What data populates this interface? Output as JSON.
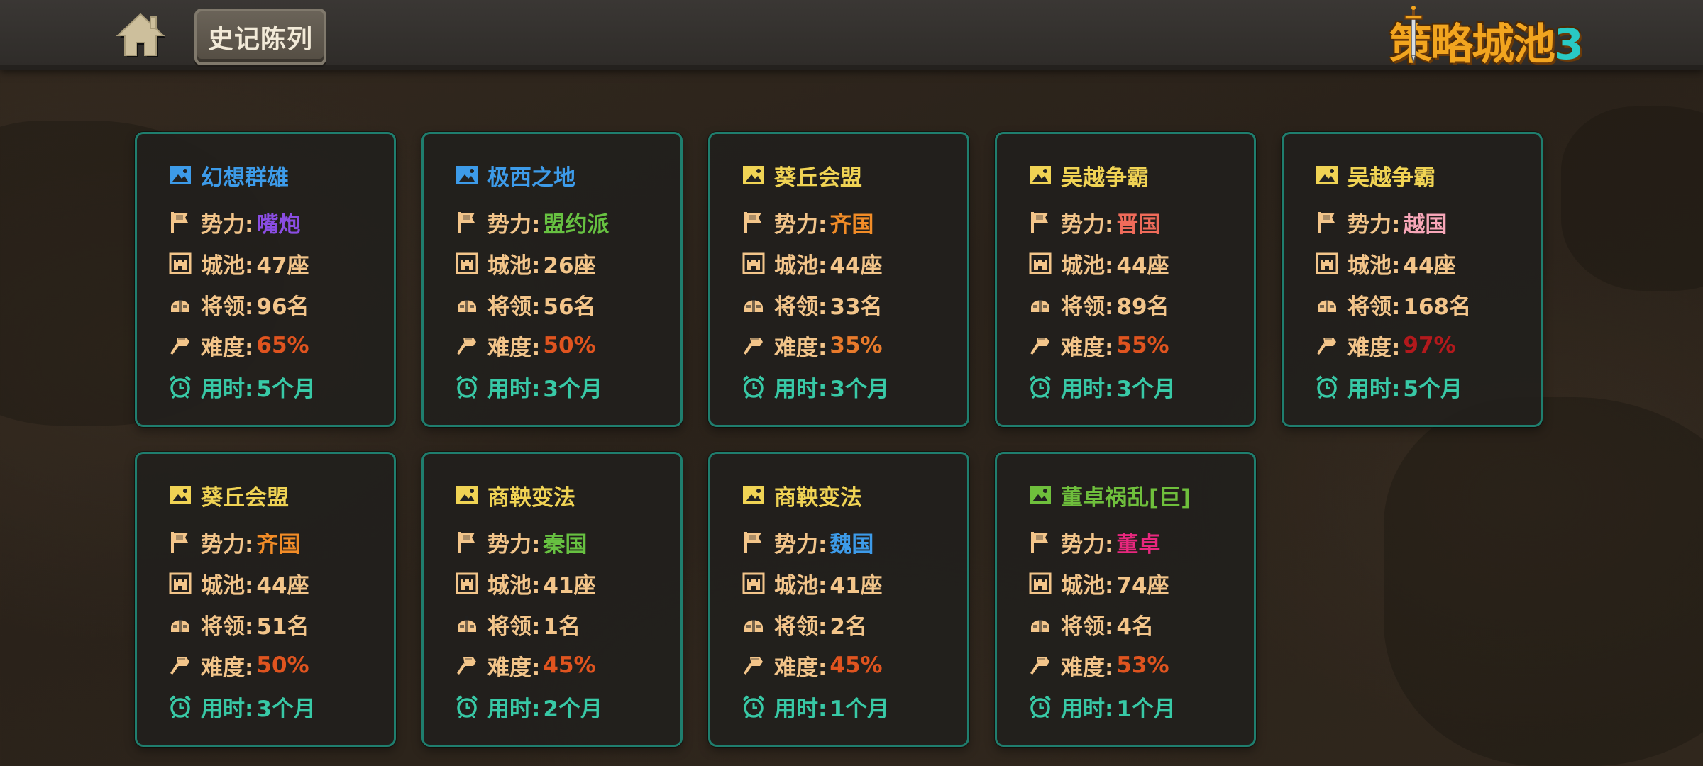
{
  "header": {
    "home_icon": "home-icon",
    "title": "史记陈列",
    "logo_text": "策略城池",
    "logo_num": "3"
  },
  "labels": {
    "faction": "势力:",
    "cities": "城池:",
    "generals": "将领:",
    "difficulty": "难度:",
    "time": "用时:"
  },
  "icons": {
    "title": "picture-icon",
    "faction": "flag-icon",
    "cities": "castle-icon",
    "generals": "helmet-icon",
    "difficulty": "hammer-icon",
    "time": "alarm-clock-icon"
  },
  "records": [
    {
      "title": "幻想群雄",
      "title_color": "#3d9be9",
      "icon_color": "#3d9be9",
      "faction": "嘴炮",
      "faction_color": "#8a4de2",
      "cities": "47座",
      "generals": "96名",
      "difficulty": "65%",
      "difficulty_color": "#e0541f",
      "time": "5个月"
    },
    {
      "title": "极西之地",
      "title_color": "#3d9be9",
      "icon_color": "#3d9be9",
      "faction": "盟约派",
      "faction_color": "#67c141",
      "cities": "26座",
      "generals": "56名",
      "difficulty": "50%",
      "difficulty_color": "#e0541f",
      "time": "3个月"
    },
    {
      "title": "葵丘会盟",
      "title_color": "#f0d354",
      "icon_color": "#f0d354",
      "faction": "齐国",
      "faction_color": "#f28c27",
      "cities": "44座",
      "generals": "33名",
      "difficulty": "35%",
      "difficulty_color": "#e87a2b",
      "time": "3个月"
    },
    {
      "title": "吴越争霸",
      "title_color": "#f0d354",
      "icon_color": "#f0d354",
      "faction": "晋国",
      "faction_color": "#ef6b5a",
      "cities": "44座",
      "generals": "89名",
      "difficulty": "55%",
      "difficulty_color": "#e0541f",
      "time": "3个月"
    },
    {
      "title": "吴越争霸",
      "title_color": "#f0d354",
      "icon_color": "#f0d354",
      "faction": "越国",
      "faction_color": "#f7a6b8",
      "cities": "44座",
      "generals": "168名",
      "difficulty": "97%",
      "difficulty_color": "#b3191c",
      "time": "5个月"
    },
    {
      "title": "葵丘会盟",
      "title_color": "#f0d354",
      "icon_color": "#f0d354",
      "faction": "齐国",
      "faction_color": "#f28c27",
      "cities": "44座",
      "generals": "51名",
      "difficulty": "50%",
      "difficulty_color": "#e0541f",
      "time": "3个月"
    },
    {
      "title": "商鞅变法",
      "title_color": "#f0d354",
      "icon_color": "#f0d354",
      "faction": "秦国",
      "faction_color": "#67c141",
      "cities": "41座",
      "generals": "1名",
      "difficulty": "45%",
      "difficulty_color": "#e0541f",
      "time": "2个月"
    },
    {
      "title": "商鞅变法",
      "title_color": "#f0d354",
      "icon_color": "#f0d354",
      "faction": "魏国",
      "faction_color": "#3d9be9",
      "cities": "41座",
      "generals": "2名",
      "difficulty": "45%",
      "difficulty_color": "#e0541f",
      "time": "1个月"
    },
    {
      "title": "董卓祸乱[巨]",
      "title_color": "#6fbf3c",
      "icon_color": "#6fbf3c",
      "faction": "董卓",
      "faction_color": "#e8277e",
      "cities": "74座",
      "generals": "4名",
      "difficulty": "53%",
      "difficulty_color": "#e0541f",
      "time": "1个月"
    }
  ]
}
